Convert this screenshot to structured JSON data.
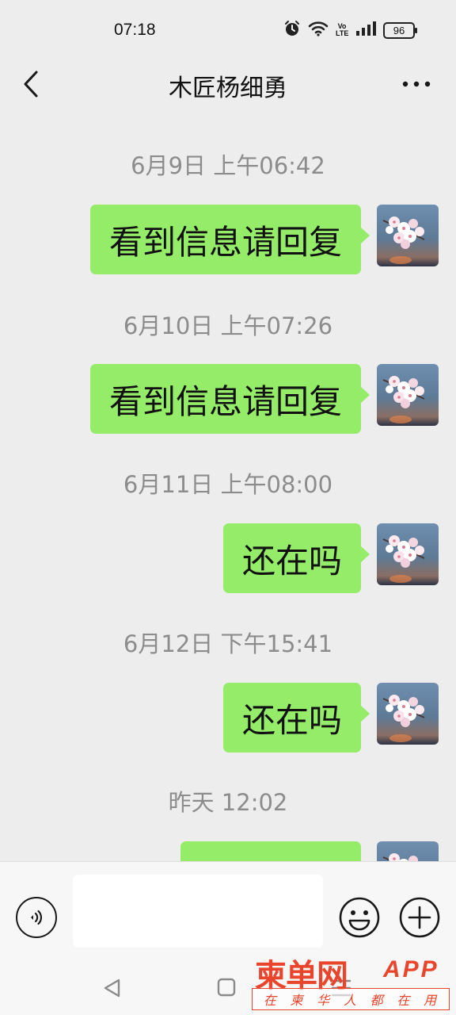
{
  "status_bar": {
    "time": "07:18",
    "battery": "96",
    "volte": "VoLTE",
    "icons": [
      "alarm-icon",
      "wifi-icon",
      "volte-icon",
      "signal-icon",
      "battery-icon"
    ]
  },
  "header": {
    "title": "木匠杨细勇",
    "back_icon": "chevron-left-icon",
    "more_icon": "more-dots-icon"
  },
  "messages": [
    {
      "timestamp": "6月9日 上午06:42",
      "text": "看到信息请回复"
    },
    {
      "timestamp": "6月10日 上午07:26",
      "text": "看到信息请回复"
    },
    {
      "timestamp": "6月11日 上午08:00",
      "text": "还在吗"
    },
    {
      "timestamp": "6月12日 下午15:41",
      "text": "还在吗"
    },
    {
      "timestamp": "昨天 12:02",
      "text": ""
    }
  ],
  "input_bar": {
    "value": "",
    "voice_icon": "voice-icon",
    "emoji_icon": "emoji-icon",
    "plus_icon": "plus-icon"
  },
  "watermark": {
    "logo": "柬单网",
    "app": "APP",
    "slogan": [
      "在",
      "柬",
      "华",
      "人",
      "都",
      "在",
      "用"
    ]
  },
  "colors": {
    "background": "#ededed",
    "bubble": "#95ec69",
    "timestamp": "#8c8c8c",
    "watermark": "#e8452c"
  }
}
